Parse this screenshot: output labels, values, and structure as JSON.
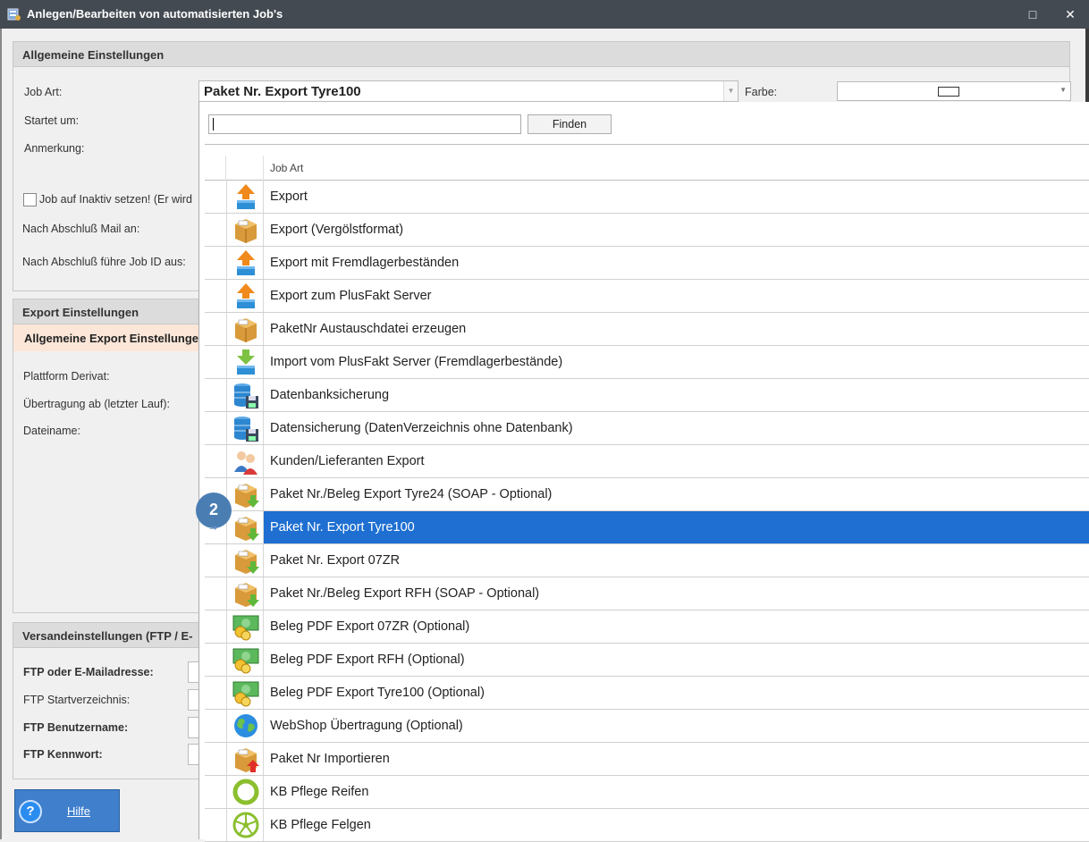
{
  "window": {
    "title": "Anlegen/Bearbeiten von automatisierten Job's",
    "minimize": "□",
    "close": "✕"
  },
  "general": {
    "header": "Allgemeine Einstellungen",
    "job_art_label": "Job Art:",
    "job_art_value": "Paket Nr. Export Tyre100",
    "farbe_label": "Farbe:",
    "startet_label": "Startet um:",
    "anmerkung_label": "Anmerkung:",
    "inaktiv_label": "Job auf Inaktiv setzen! (Er wird",
    "mail_label": "Nach Abschluß Mail an:",
    "jobid_label": "Nach Abschluß führe Job ID aus:"
  },
  "export": {
    "header": "Export Einstellungen",
    "subheader": "Allgemeine Export Einstellunge",
    "plattform_label": "Plattform Derivat:",
    "uebertragung_label": "Übertragung ab (letzter Lauf):",
    "dateiname_label": "Dateiname:"
  },
  "versand": {
    "header": "Versandeinstellungen (FTP / E-",
    "ftp_mail_label": "FTP oder E-Mailadresse:",
    "ftp_start_label": "FTP Startverzeichnis:",
    "ftp_user_label": "FTP Benutzername:",
    "ftp_pw_label": "FTP Kennwort:"
  },
  "help": {
    "label": "Hilfe",
    "q": "?"
  },
  "popup": {
    "search_value": "",
    "find_button": "Finden",
    "column_header": "Job Art",
    "badge": "2",
    "items": [
      {
        "label": "Export",
        "icon": "export-arrow-up"
      },
      {
        "label": "Export (Vergölstformat)",
        "icon": "package-box"
      },
      {
        "label": "Export mit Fremdlagerbeständen",
        "icon": "export-arrow-up"
      },
      {
        "label": "Export zum PlusFakt Server",
        "icon": "export-arrow-up"
      },
      {
        "label": "PaketNr Austauschdatei erzeugen",
        "icon": "package-box"
      },
      {
        "label": "Import vom PlusFakt Server (Fremdlagerbestände)",
        "icon": "import-arrow-down"
      },
      {
        "label": "Datenbanksicherung",
        "icon": "database-save"
      },
      {
        "label": "Datensicherung (DatenVerzeichnis ohne Datenbank)",
        "icon": "database-save"
      },
      {
        "label": "Kunden/Lieferanten Export",
        "icon": "users"
      },
      {
        "label": "Paket Nr./Beleg Export Tyre24 (SOAP - Optional)",
        "icon": "package-green-arrow"
      },
      {
        "label": "Paket Nr. Export Tyre100",
        "icon": "package-green-arrow",
        "selected": true
      },
      {
        "label": "Paket Nr. Export 07ZR",
        "icon": "package-green-arrow"
      },
      {
        "label": "Paket Nr./Beleg Export RFH (SOAP - Optional)",
        "icon": "package-green-arrow"
      },
      {
        "label": "Beleg PDF Export 07ZR (Optional)",
        "icon": "money-coins"
      },
      {
        "label": "Beleg PDF Export RFH (Optional)",
        "icon": "money-coins"
      },
      {
        "label": "Beleg PDF Export Tyre100 (Optional)",
        "icon": "money-coins"
      },
      {
        "label": "WebShop Übertragung (Optional)",
        "icon": "globe"
      },
      {
        "label": "Paket Nr Importieren",
        "icon": "package-red-arrow"
      },
      {
        "label": "KB Pflege Reifen",
        "icon": "tire-ring"
      },
      {
        "label": "KB Pflege Felgen",
        "icon": "rim-wheel"
      }
    ]
  },
  "colors": {
    "selection": "#1e6fd1",
    "titlebar": "#444a52"
  }
}
